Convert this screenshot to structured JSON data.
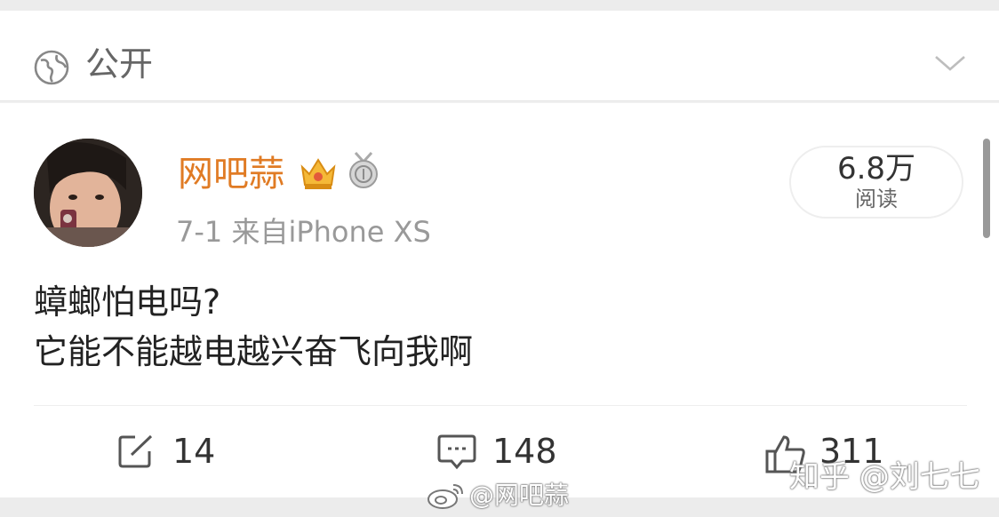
{
  "visibility": {
    "label": "公开"
  },
  "post": {
    "username": "网吧蒜",
    "meta": "7-1  来自iPhone XS",
    "reads_count": "6.8万",
    "reads_label": "阅读",
    "body_lines": [
      "蟑螂怕电吗?",
      "它能不能越电越兴奋飞向我啊"
    ]
  },
  "actions": {
    "repost_count": "14",
    "comment_count": "148",
    "like_count": "311"
  },
  "watermarks": {
    "weibo": "@网吧蒜",
    "zhihu": "知乎 @刘七七"
  },
  "colors": {
    "username": "#e07b24",
    "meta": "#999999",
    "background": "#f0f0f0"
  },
  "icons": [
    "globe-icon",
    "chevron-down-icon",
    "crown-icon",
    "medal-icon",
    "repost-icon",
    "comment-icon",
    "like-icon",
    "weibo-logo-icon"
  ]
}
